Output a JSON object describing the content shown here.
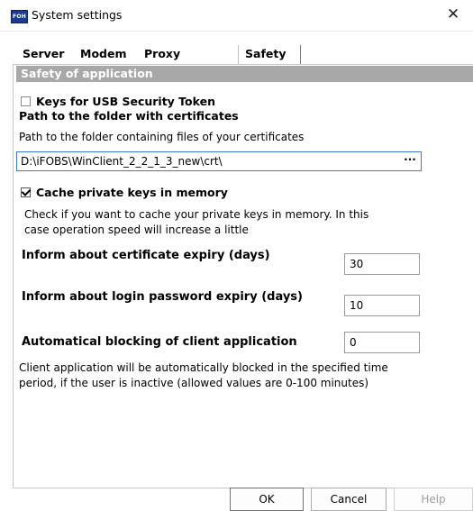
{
  "window": {
    "icon_label": "FOH",
    "title": "System settings",
    "close_glyph": "✕"
  },
  "tabs": [
    {
      "label": "Server"
    },
    {
      "label": "Modem"
    },
    {
      "label": "Proxy server"
    },
    {
      "label": "Safety",
      "active": true
    }
  ],
  "safety": {
    "group_title": "Safety of application",
    "usb_token": {
      "label": "Keys for USB Security Token",
      "checked": false
    },
    "cert_folder": {
      "title": "Path to the folder with certificates",
      "description": "Path to the folder containing files of your certificates",
      "value": "D:\\iFOBS\\WinClient_2_2_1_3_new\\crt\\",
      "browse_label": "···"
    },
    "cache_keys": {
      "label": "Cache private keys in memory",
      "checked": true,
      "description_line1": "Check if you want to cache your private keys in memory. In this",
      "description_line2": "case operation speed will increase a little"
    },
    "cert_expiry": {
      "label": "Inform about certificate expiry (days)",
      "value": "30"
    },
    "password_expiry": {
      "label": "Inform about login password expiry (days)",
      "value": "10"
    },
    "auto_block": {
      "label": "Automatical blocking of client application",
      "value": "0",
      "description_line1": "Client application will be automatically blocked in the specified time",
      "description_line2": "period, if the user is inactive (allowed values are 0-100 minutes)"
    }
  },
  "buttons": {
    "ok": "OK",
    "cancel": "Cancel",
    "help": "Help"
  }
}
